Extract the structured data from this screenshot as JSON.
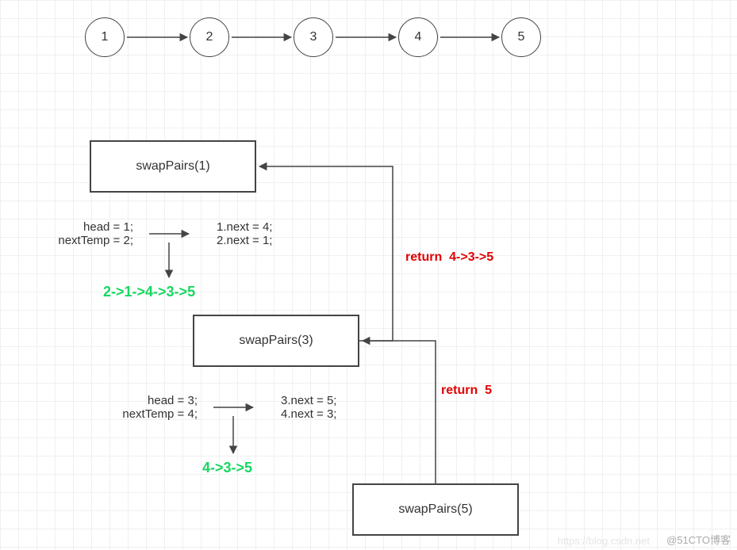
{
  "linked_list": {
    "nodes": [
      "1",
      "2",
      "3",
      "4",
      "5"
    ]
  },
  "calls": {
    "call1": {
      "title": "swapPairs(1)",
      "vars_left": "head = 1;\nnextTemp = 2;",
      "vars_right": "1.next = 4;\n2.next = 1;",
      "result": "2->1->4->3->5",
      "return_label": "return  4->3->5"
    },
    "call2": {
      "title": "swapPairs(3)",
      "vars_left": "head = 3;\nnextTemp = 4;",
      "vars_right": "3.next = 5;\n4.next = 3;",
      "result": "4->3->5",
      "return_label": "return  5"
    },
    "call3": {
      "title": "swapPairs(5)"
    }
  },
  "watermark_main": "@51CTO博客",
  "watermark_faint": "https://blog.csdn.net",
  "chart_data": {
    "type": "diagram",
    "description": "Recursion trace of swapPairs on linked list 1->2->3->4->5",
    "linked_list": [
      1,
      2,
      3,
      4,
      5
    ],
    "recursion": [
      {
        "call": "swapPairs(1)",
        "head": 1,
        "nextTemp": 2,
        "post_assignments": [
          "1.next = 4",
          "2.next = 1"
        ],
        "returns": "2->1->4->3->5",
        "receives_from_child": "4->3->5"
      },
      {
        "call": "swapPairs(3)",
        "head": 3,
        "nextTemp": 4,
        "post_assignments": [
          "3.next = 5",
          "4.next = 3"
        ],
        "returns": "4->3->5",
        "receives_from_child": "5"
      },
      {
        "call": "swapPairs(5)",
        "returns": "5"
      }
    ]
  }
}
